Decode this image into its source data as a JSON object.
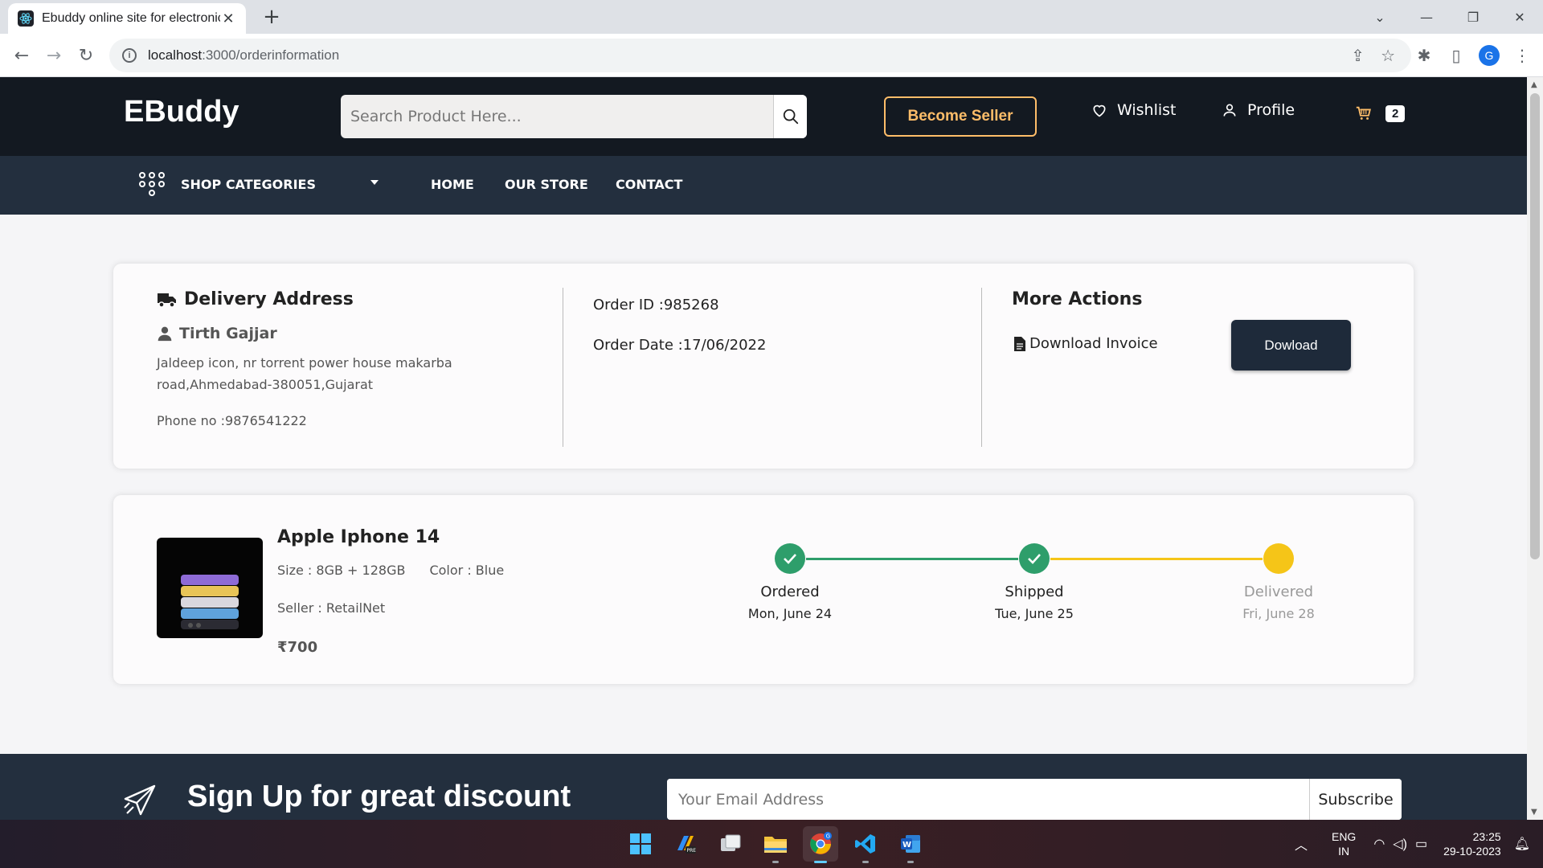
{
  "browser": {
    "tab_title": "Ebuddy online site for electronic",
    "url_host": "localhost",
    "url_rest": ":3000/orderinformation"
  },
  "header": {
    "brand": "EBuddy",
    "search_placeholder": "Search Product Here...",
    "become_seller": "Become Seller",
    "wishlist": "Wishlist",
    "profile": "Profile",
    "cart_count": "2"
  },
  "nav": {
    "categories": "SHOP CATEGORIES",
    "home": "HOME",
    "store": "OUR STORE",
    "contact": "CONTACT"
  },
  "delivery": {
    "title": "Delivery Address",
    "name": "Tirth Gajjar",
    "address": "Jaldeep icon, nr torrent power house makarba road,Ahmedabad-380051,Gujarat",
    "phone": "Phone no :9876541222"
  },
  "order": {
    "id": "Order ID :985268",
    "date": "Order Date :17/06/2022"
  },
  "actions": {
    "title": "More Actions",
    "invoice": "Download Invoice",
    "download_btn": "Dowload"
  },
  "product": {
    "name": "Apple Iphone 14",
    "size": "Size : 8GB + 128GB",
    "color": "Color : Blue",
    "seller": "Seller : RetailNet",
    "price": "₹700"
  },
  "tracking": {
    "steps": [
      {
        "label": "Ordered",
        "date": "Mon, June 24",
        "done": true
      },
      {
        "label": "Shipped",
        "date": "Tue, June 25",
        "done": true
      },
      {
        "label": "Delivered",
        "date": "Fri, June 28",
        "done": false
      }
    ],
    "colors": {
      "done": "#2e9e6b",
      "pending": "#f5c518"
    }
  },
  "footer": {
    "signup": "Sign Up for great discount",
    "email_placeholder": "Your Email Address",
    "subscribe": "Subscribe"
  },
  "taskbar": {
    "lang_top": "ENG",
    "lang_bottom": "IN",
    "time": "23:25",
    "date": "29-10-2023"
  },
  "colors": {
    "header_bg": "#131921",
    "nav_bg": "#232f3e",
    "accent": "#febd69"
  }
}
